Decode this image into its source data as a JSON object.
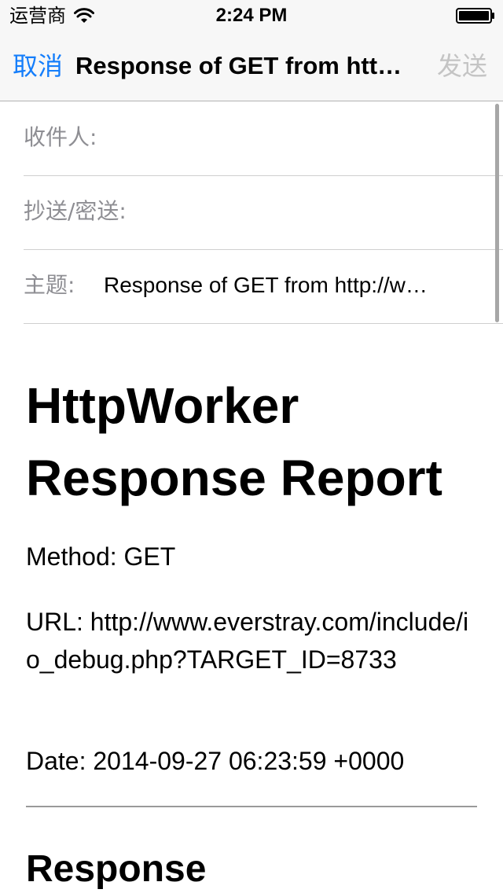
{
  "status_bar": {
    "carrier": "运营商",
    "time": "2:24 PM",
    "wifi_icon": "wifi-icon",
    "battery_icon": "battery-icon"
  },
  "nav": {
    "cancel_label": "取消",
    "title": "Response of GET from htt…",
    "send_label": "发送"
  },
  "fields": {
    "to_label": "收件人:",
    "to_value": "",
    "cc_label": "抄送/密送:",
    "cc_value": "",
    "subject_label": "主题:",
    "subject_value": "Response of GET from http://w…"
  },
  "body": {
    "title": "HttpWorker Response Report",
    "method": "Method: GET",
    "url": "URL: http://www.everstray.com/include/io_debug.php?TARGET_ID=8733",
    "date": "Date: 2014-09-27 06:23:59 +0000",
    "section_title": "Response"
  },
  "colors": {
    "accent": "#157efb",
    "disabled": "#c4c4c4",
    "label_gray": "#8e8e93",
    "bar_background": "#f7f7f7"
  }
}
